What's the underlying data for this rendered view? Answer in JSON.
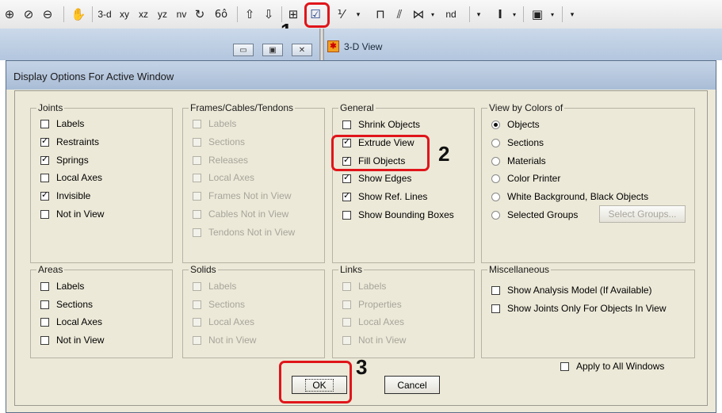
{
  "toolbar": {
    "items": [
      {
        "name": "zoom-in-icon",
        "glyph": "⊕"
      },
      {
        "name": "zoom-window-icon",
        "glyph": "⊘"
      },
      {
        "name": "zoom-out-icon",
        "glyph": "⊖"
      },
      {
        "name": "pan-icon",
        "glyph": "✋"
      },
      {
        "name": "view-3d-button",
        "label": "3-d"
      },
      {
        "name": "view-xy-button",
        "label": "xy"
      },
      {
        "name": "view-xz-button",
        "label": "xz"
      },
      {
        "name": "view-yz-button",
        "label": "yz"
      },
      {
        "name": "view-nv-button",
        "label": "nv"
      },
      {
        "name": "rotate-icon",
        "glyph": "↻"
      },
      {
        "name": "perspective-icon",
        "glyph": "6ô"
      },
      {
        "name": "move-up-icon",
        "glyph": "⇧"
      },
      {
        "name": "move-down-icon",
        "glyph": "⇩"
      },
      {
        "name": "grid-object-icon",
        "glyph": "⊞"
      },
      {
        "name": "display-options-icon",
        "glyph": "☑"
      },
      {
        "name": "shrink-icon",
        "glyph": "⅟"
      },
      {
        "name": "frame-icon",
        "glyph": "⊓"
      },
      {
        "name": "frame-perspective-icon",
        "glyph": "⫽"
      },
      {
        "name": "section-cut-icon",
        "glyph": "⋈"
      },
      {
        "name": "view-nd-button",
        "label": "nd"
      },
      {
        "name": "text-cursor-icon",
        "glyph": "I"
      },
      {
        "name": "show-tables-icon",
        "glyph": "▣"
      }
    ]
  },
  "markers": {
    "one": "1",
    "two": "2",
    "three": "3"
  },
  "window": {
    "view_title": "3-D View",
    "minimize": "▭",
    "restore": "▣",
    "close": "✕"
  },
  "dialog": {
    "title": "Display Options For Active Window",
    "joints": {
      "title": "Joints",
      "items": [
        {
          "label": "Labels",
          "checked": false
        },
        {
          "label": "Restraints",
          "checked": true
        },
        {
          "label": "Springs",
          "checked": true
        },
        {
          "label": "Local Axes",
          "checked": false
        },
        {
          "label": "Invisible",
          "checked": true
        },
        {
          "label": "Not in View",
          "checked": false
        }
      ]
    },
    "frames": {
      "title": "Frames/Cables/Tendons",
      "items": [
        {
          "label": "Labels"
        },
        {
          "label": "Sections"
        },
        {
          "label": "Releases"
        },
        {
          "label": "Local Axes"
        },
        {
          "label": "Frames Not in View"
        },
        {
          "label": "Cables Not in View"
        },
        {
          "label": "Tendons Not in View"
        }
      ]
    },
    "general": {
      "title": "General",
      "items": [
        {
          "label": "Shrink Objects",
          "checked": false
        },
        {
          "label": "Extrude View",
          "checked": true
        },
        {
          "label": "Fill Objects",
          "checked": true
        },
        {
          "label": "Show Edges",
          "checked": true
        },
        {
          "label": "Show Ref. Lines",
          "checked": true
        },
        {
          "label": "Show Bounding Boxes",
          "checked": false
        }
      ]
    },
    "colors": {
      "title": "View by Colors of",
      "items": [
        {
          "label": "Objects",
          "selected": true
        },
        {
          "label": "Sections",
          "selected": false
        },
        {
          "label": "Materials",
          "selected": false
        },
        {
          "label": "Color Printer",
          "selected": false
        },
        {
          "label": "White Background, Black Objects",
          "selected": false
        },
        {
          "label": "Selected Groups",
          "selected": false
        }
      ],
      "select_groups_button": "Select Groups..."
    },
    "areas": {
      "title": "Areas",
      "items": [
        {
          "label": "Labels",
          "checked": false
        },
        {
          "label": "Sections",
          "checked": false
        },
        {
          "label": "Local Axes",
          "checked": false
        },
        {
          "label": "Not in View",
          "checked": false
        }
      ]
    },
    "solids": {
      "title": "Solids",
      "items": [
        {
          "label": "Labels"
        },
        {
          "label": "Sections"
        },
        {
          "label": "Local Axes"
        },
        {
          "label": "Not in View"
        }
      ]
    },
    "links": {
      "title": "Links",
      "items": [
        {
          "label": "Labels"
        },
        {
          "label": "Properties"
        },
        {
          "label": "Local Axes"
        },
        {
          "label": "Not in View"
        }
      ]
    },
    "misc": {
      "title": "Miscellaneous",
      "items": [
        {
          "label": "Show Analysis Model  (If Available)",
          "checked": false
        },
        {
          "label": "Show Joints Only For Objects In View",
          "checked": false
        }
      ]
    },
    "apply_all": {
      "label": "Apply to All Windows",
      "checked": false
    },
    "ok_label": "OK",
    "cancel_label": "Cancel"
  },
  "colors": {
    "highlight": "#e0151a",
    "dialog_bg": "#ece9d8",
    "title_bar": "#b3c6de"
  }
}
